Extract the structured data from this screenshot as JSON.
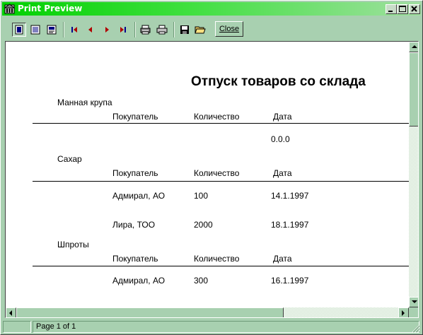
{
  "window": {
    "title": "Print Preview"
  },
  "toolbar": {
    "tools": [
      {
        "name": "whole-page-icon"
      },
      {
        "name": "page-width-icon"
      },
      {
        "name": "zoom-100-icon"
      },
      {
        "name": "first-page-icon"
      },
      {
        "name": "prior-page-icon"
      },
      {
        "name": "next-page-icon"
      },
      {
        "name": "last-page-icon"
      },
      {
        "name": "print-setup-icon"
      },
      {
        "name": "print-icon"
      },
      {
        "name": "save-icon"
      },
      {
        "name": "open-icon"
      }
    ],
    "close_label": "Close"
  },
  "report": {
    "title": "Отпуск товаров со склада",
    "columns": {
      "buyer": "Покупатель",
      "quantity": "Количество",
      "date": "Дата"
    },
    "groups": [
      {
        "name": "Манная крупа",
        "rows": [
          {
            "buyer": "",
            "quantity": "",
            "date": "0.0.0"
          }
        ]
      },
      {
        "name": "Сахар",
        "rows": [
          {
            "buyer": "Адмирал, АО",
            "quantity": "100",
            "date": "14.1.1997"
          },
          {
            "buyer": "Лира, ТОО",
            "quantity": "2000",
            "date": "18.1.1997"
          }
        ]
      },
      {
        "name": "Шпроты",
        "rows": [
          {
            "buyer": "Адмирал, АО",
            "quantity": "300",
            "date": "16.1.1997"
          }
        ]
      }
    ]
  },
  "status": {
    "page": "Page 1 of 1"
  },
  "colors": {
    "face": "#a8d0b0",
    "title_start": "#00d000",
    "title_end": "#a0e0a0",
    "paper": "#ffffff"
  }
}
